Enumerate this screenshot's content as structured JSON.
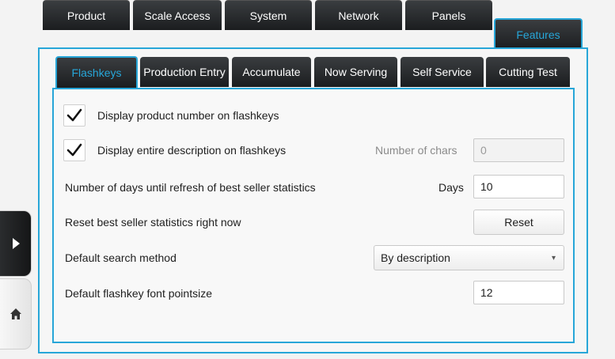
{
  "top_tabs": [
    {
      "label": "Product",
      "active": false
    },
    {
      "label": "Scale Access",
      "active": false
    },
    {
      "label": "System",
      "active": false
    },
    {
      "label": "Network",
      "active": false
    },
    {
      "label": "Panels",
      "active": false
    },
    {
      "label": "Features",
      "active": true
    }
  ],
  "sub_tabs": [
    {
      "label": "Flashkeys",
      "active": true
    },
    {
      "label": "Production Entry",
      "active": false
    },
    {
      "label": "Accumulate",
      "active": false
    },
    {
      "label": "Now Serving",
      "active": false
    },
    {
      "label": "Self Service",
      "active": false
    },
    {
      "label": "Cutting Test",
      "active": false
    }
  ],
  "settings": {
    "display_product_number": {
      "label": "Display product number on flashkeys",
      "checked": true
    },
    "display_entire_description": {
      "label": "Display entire description on flashkeys",
      "checked": true
    },
    "number_of_chars": {
      "label": "Number of chars",
      "value": "0"
    },
    "refresh_days": {
      "label": "Number of days until refresh of best seller statistics",
      "unit_label": "Days",
      "value": "10"
    },
    "reset_stats": {
      "label": "Reset best seller statistics right now",
      "button_label": "Reset"
    },
    "search_method": {
      "label": "Default search method",
      "value": "By description"
    },
    "font_pointsize": {
      "label": "Default flashkey font pointsize",
      "value": "12"
    }
  },
  "colors": {
    "accent": "#27a6d8",
    "tab_dark": "#1b1d1f",
    "panel_bg": "#f8f8f8"
  },
  "icons": {
    "expand": "play-arrow-icon",
    "home": "home-icon",
    "check": "checkmark-icon",
    "dropdown": "chevron-down-icon"
  }
}
